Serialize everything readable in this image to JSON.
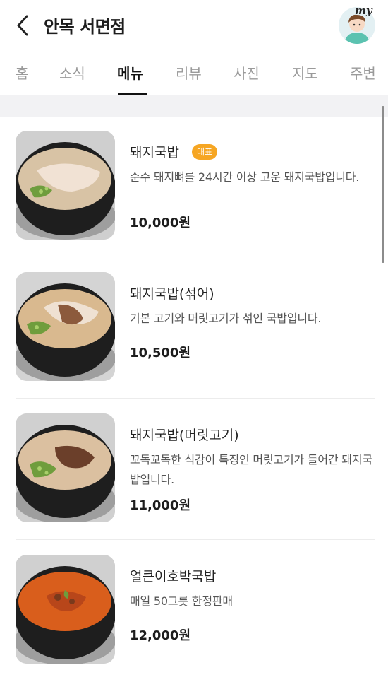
{
  "header": {
    "title": "안목 서면점",
    "back_icon": "chevron-left-icon",
    "avatar_text": "my"
  },
  "tabs": [
    {
      "label": "홈",
      "active": false
    },
    {
      "label": "소식",
      "active": false
    },
    {
      "label": "메뉴",
      "active": true
    },
    {
      "label": "리뷰",
      "active": false
    },
    {
      "label": "사진",
      "active": false
    },
    {
      "label": "지도",
      "active": false
    },
    {
      "label": "주변",
      "active": false
    }
  ],
  "colors": {
    "badge": "#f6a623",
    "active_tab": "#111111",
    "inactive_tab": "#9a9a9a"
  },
  "menu": [
    {
      "name": "돼지국밥",
      "badge": "대표",
      "desc": "순수 돼지뼈를 24시간 이상 고운 돼지국밥입니다.",
      "price": "10,000원",
      "broth": "light"
    },
    {
      "name": "돼지국밥(섞어)",
      "desc": "기본 고기와 머릿고기가 섞인 국밥입니다.",
      "price": "10,500원",
      "broth": "light"
    },
    {
      "name": "돼지국밥(머릿고기)",
      "desc": "꼬독꼬독한 식감이 특징인 머릿고기가 들어간 돼지국밥입니다.",
      "price": "11,000원",
      "broth": "light"
    },
    {
      "name": "얼큰이호박국밥",
      "desc": "매일 50그릇 한정판매",
      "price": "12,000원",
      "broth": "spicy"
    }
  ]
}
